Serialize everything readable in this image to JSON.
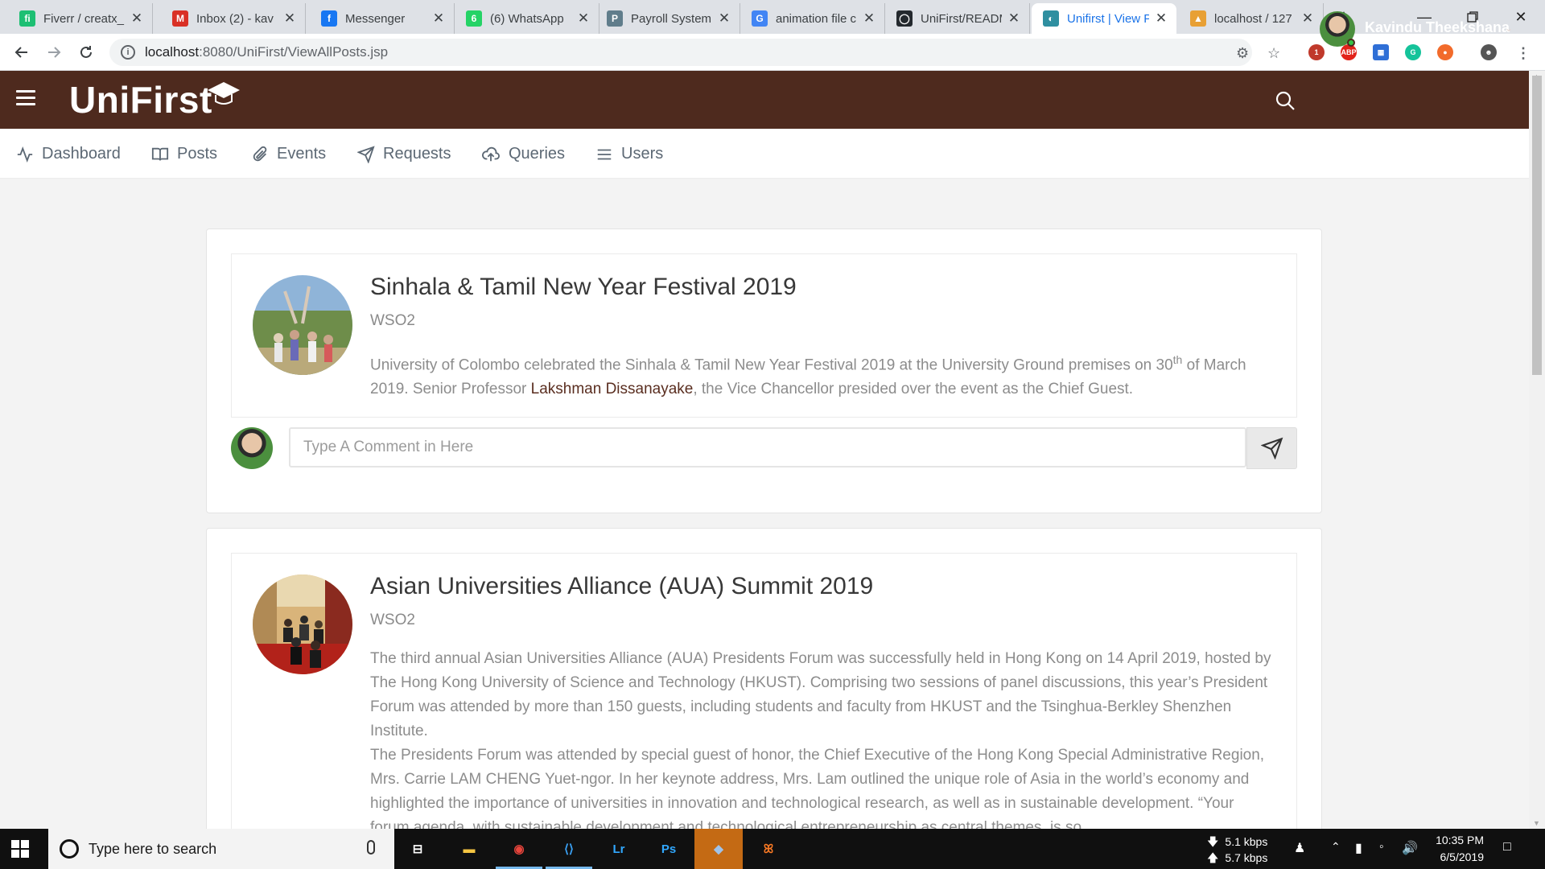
{
  "browser": {
    "tabs": [
      {
        "title": "Fiverr / creatx_",
        "favicon": "fiverr-favicon",
        "color": "#1dbf73",
        "glyph": "fi"
      },
      {
        "title": "Inbox (2) - kav",
        "favicon": "gmail-favicon",
        "color": "#d93025",
        "glyph": "M"
      },
      {
        "title": "Messenger",
        "favicon": "facebook-favicon",
        "color": "#1877f2",
        "glyph": "f"
      },
      {
        "title": "(6) WhatsApp",
        "favicon": "whatsapp-favicon",
        "color": "#25d366",
        "glyph": "6"
      },
      {
        "title": "Payroll System",
        "favicon": "payroll-favicon",
        "color": "#607d8b",
        "glyph": "P"
      },
      {
        "title": "animation file c",
        "favicon": "google-favicon",
        "color": "#4285f4",
        "glyph": "G"
      },
      {
        "title": "UniFirst/READM",
        "favicon": "github-favicon",
        "color": "#24292e",
        "glyph": "◯"
      },
      {
        "title": "Unifirst | View P",
        "favicon": "unifirst-favicon",
        "color": "#2f8fa0",
        "glyph": "◐",
        "active": true
      },
      {
        "title": "localhost / 127",
        "favicon": "phpmyadmin-favicon",
        "color": "#e8a034",
        "glyph": "▲"
      }
    ],
    "url_host": "localhost",
    "url_rest": ":8080/UniFirst/ViewAllPosts.jsp"
  },
  "app": {
    "logo_text": "UniFirst",
    "user_name": "Kavindu Theekshana",
    "nav": [
      {
        "label": "Dashboard",
        "icon": "activity-icon"
      },
      {
        "label": "Posts",
        "icon": "book-icon"
      },
      {
        "label": "Events",
        "icon": "paperclip-icon"
      },
      {
        "label": "Requests",
        "icon": "send-icon"
      },
      {
        "label": "Queries",
        "icon": "cloud-upload-icon"
      },
      {
        "label": "Users",
        "icon": "list-icon"
      }
    ]
  },
  "posts": [
    {
      "title": "Sinhala & Tamil New Year Festival 2019",
      "organization": "WSO2",
      "body_before": "University of Colombo celebrated the Sinhala & Tamil New Year Festival 2019 at the University Ground premises on 30",
      "body_sup": "th",
      "body_mid": " of March 2019. Senior Professor ",
      "body_highlight": "Lakshman Dissanayake",
      "body_after": ", the Vice Chancellor presided over the event as the Chief Guest.",
      "comment_placeholder": "Type A Comment in Here"
    },
    {
      "title": "Asian Universities Alliance (AUA) Summit 2019",
      "organization": "WSO2",
      "body_p1": "The third annual Asian Universities Alliance (AUA) Presidents Forum was successfully held in Hong Kong on 14 April 2019, hosted by The Hong Kong University of Science and Technology (HKUST). Comprising two sessions of panel discussions, this year’s President Forum was attended by more than 150 guests, including students and faculty from HKUST and the Tsinghua-Berkley Shenzhen Institute.",
      "body_p2": "The Presidents Forum was attended by special guest of honor, the Chief Executive of the Hong Kong Special Administrative Region, Mrs. Carrie LAM CHENG Yuet-ngor. In her keynote address, Mrs. Lam outlined the unique role of Asia in the world’s economy and highlighted the importance of universities in innovation and technological research, as well as in sustainable development. “Your forum agenda, with sustainable development and technological entrepreneurship as central themes, is so"
    }
  ],
  "taskbar": {
    "search_placeholder": "Type here to search",
    "apps": [
      {
        "name": "task-view-icon",
        "glyph": "⊟",
        "color": "#ffffff"
      },
      {
        "name": "file-explorer-icon",
        "glyph": "▬",
        "color": "#f5c542"
      },
      {
        "name": "chrome-icon",
        "glyph": "◉",
        "color": "#e8453c",
        "running": true
      },
      {
        "name": "vscode-icon",
        "glyph": "⟨⟩",
        "color": "#3aa0f3",
        "running": true
      },
      {
        "name": "lightroom-icon",
        "glyph": "Lr",
        "color": "#31a8ff"
      },
      {
        "name": "photoshop-icon",
        "glyph": "Ps",
        "color": "#31a8ff"
      },
      {
        "name": "virtualbox-icon",
        "glyph": "◆",
        "color": "#9fc3ea",
        "running": true
      },
      {
        "name": "xampp-icon",
        "glyph": "ꕤ",
        "color": "#fb7a24"
      }
    ],
    "net_down": "5.1 kbps",
    "net_up": "5.7 kbps",
    "time": "10:35 PM",
    "date": "6/5/2019"
  }
}
